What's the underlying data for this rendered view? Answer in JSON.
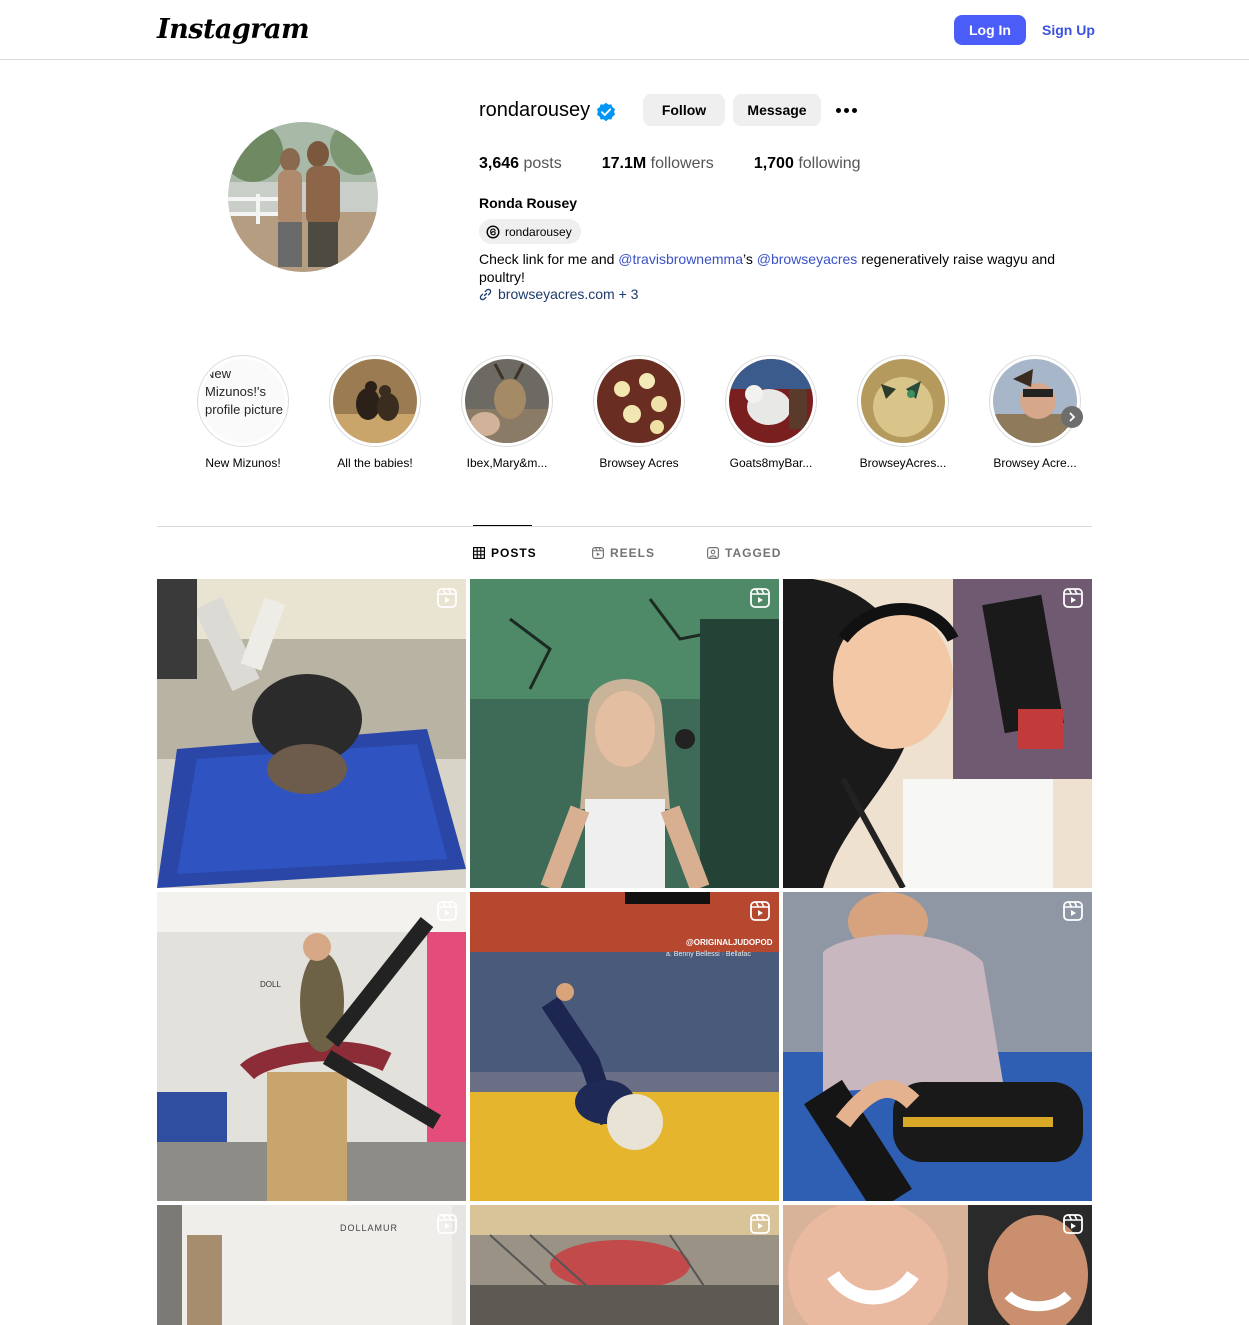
{
  "header": {
    "logo_text": "Instagram",
    "login_label": "Log In",
    "signup_label": "Sign Up"
  },
  "profile": {
    "username": "rondarousey",
    "follow_label": "Follow",
    "message_label": "Message",
    "stats": {
      "posts_value": "3,646",
      "posts_label": "posts",
      "followers_value": "17.1M",
      "followers_label": "followers",
      "following_value": "1,700",
      "following_label": "following"
    },
    "full_name": "Ronda Rousey",
    "threads_handle": "rondarousey",
    "bio": {
      "part1": "Check link for me and ",
      "mention1": "@travisbrownemma",
      "part2": "’s ",
      "mention2": "@browseyacres",
      "part3": " regeneratively raise wagyu and poultry!"
    },
    "link_text": "browseyacres.com",
    "link_extra": " + 3"
  },
  "highlights": [
    {
      "label": "New Mizunos!",
      "broken_alt": "New Mizunos!'s profile picture"
    },
    {
      "label": "All the babies!"
    },
    {
      "label": "Ibex,Mary&m..."
    },
    {
      "label": "Browsey Acres"
    },
    {
      "label": "Goats8myBar..."
    },
    {
      "label": "BrowseyAcres..."
    },
    {
      "label": "Browsey Acre..."
    }
  ],
  "tabs": {
    "posts": "POSTS",
    "reels": "REELS",
    "tagged": "TAGGED"
  },
  "posts": {
    "overlay_text_5": "@ORIGINALJUDOPOD",
    "overlay_text_5b": "a. Benny Bellessi · Bellafac",
    "overlay_text_7": "DOLLAMUR",
    "overlay_text_4": "DOLL"
  },
  "colors": {
    "login_button": "#4a5df9",
    "signup_text": "#3b52e0",
    "mention": "#3b52c6",
    "verified_badge": "#0095f6"
  }
}
